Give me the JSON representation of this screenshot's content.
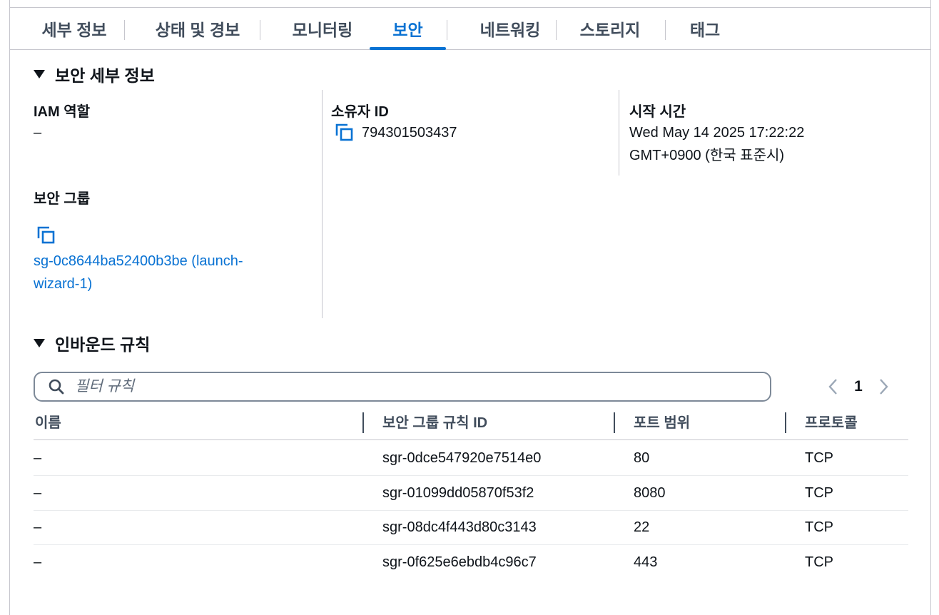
{
  "tabs": [
    {
      "label": "세부 정보"
    },
    {
      "label": "상태 및 경보"
    },
    {
      "label": "모니터링"
    },
    {
      "label": "보안"
    },
    {
      "label": "네트워킹"
    },
    {
      "label": "스토리지"
    },
    {
      "label": "태그"
    }
  ],
  "security_details": {
    "title": "보안 세부 정보",
    "iam_role": {
      "label": "IAM 역할",
      "value": "–"
    },
    "owner_id": {
      "label": "소유자 ID",
      "value": "794301503437"
    },
    "launch_time": {
      "label": "시작 시간",
      "line1": "Wed May 14 2025 17:22:22",
      "line2": "GMT+0900 (한국 표준시)"
    },
    "security_groups": {
      "label": "보안 그룹",
      "link_line1": "sg-0c8644ba52400b3be (launch-",
      "link_line2": "wizard-1)"
    }
  },
  "inbound_rules": {
    "title": "인바운드 규칙",
    "filter_placeholder": "필터 규칙",
    "page": "1",
    "columns": [
      "이름",
      "보안 그룹 규칙 ID",
      "포트 범위",
      "프로토콜"
    ],
    "rows": [
      {
        "name": "–",
        "rule_id": "sgr-0dce547920e7514e0",
        "port": "80",
        "protocol": "TCP"
      },
      {
        "name": "–",
        "rule_id": "sgr-01099dd05870f53f2",
        "port": "8080",
        "protocol": "TCP"
      },
      {
        "name": "–",
        "rule_id": "sgr-08dc4f443d80c3143",
        "port": "22",
        "protocol": "TCP"
      },
      {
        "name": "–",
        "rule_id": "sgr-0f625e6ebdb4c96c7",
        "port": "443",
        "protocol": "TCP"
      }
    ]
  },
  "icons": {
    "copy": "copy-icon",
    "search": "search-icon",
    "caret": "caret-down-icon",
    "prev": "chevron-left-icon",
    "next": "chevron-right-icon"
  },
  "colors": {
    "accent": "#0972d3",
    "text": "#0f141a",
    "muted": "#414d5c",
    "border": "#c6c6cd"
  }
}
